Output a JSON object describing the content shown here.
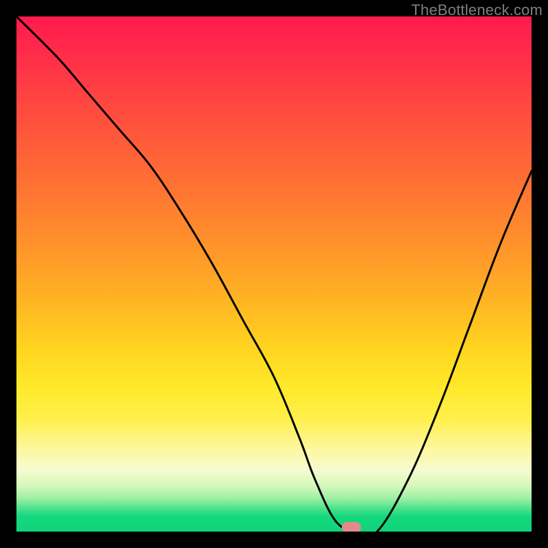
{
  "watermark": "TheBottleneck.com",
  "chart_data": {
    "type": "line",
    "title": "",
    "xlabel": "",
    "ylabel": "",
    "xlim": [
      0,
      100
    ],
    "ylim": [
      0,
      100
    ],
    "series": [
      {
        "name": "bottleneck-curve",
        "x": [
          0,
          8,
          14,
          20,
          26,
          32,
          38,
          44,
          50,
          55,
          58,
          62,
          66,
          70,
          76,
          82,
          88,
          94,
          100
        ],
        "values": [
          100,
          92,
          85,
          78,
          71,
          62,
          52,
          41,
          30,
          18,
          10,
          2,
          0,
          0,
          10,
          24,
          40,
          56,
          70
        ]
      }
    ],
    "marker": {
      "x": 65,
      "y": 0,
      "color": "#e58a8a"
    },
    "gradient_scale": {
      "top_color": "#ff1a4d",
      "bottom_color": "#0fd37b",
      "meaning": "high (red) to optimal (green)"
    }
  }
}
